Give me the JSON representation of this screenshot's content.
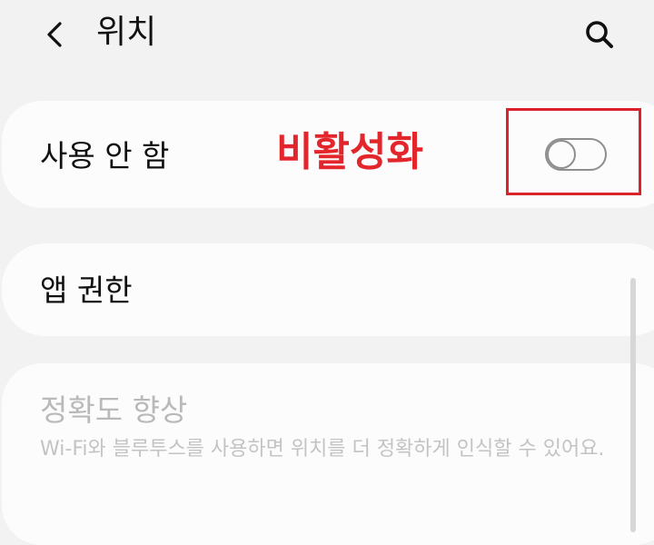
{
  "header": {
    "back_icon": "chevron-left-icon",
    "title": "위치",
    "search_icon": "search-icon"
  },
  "location_toggle": {
    "label": "사용 안 함",
    "state": "off",
    "annotation": "비활성화",
    "annotation_color": "#e3262b",
    "highlight_color": "#d9232a"
  },
  "app_permissions": {
    "label": "앱 권한"
  },
  "improve_accuracy": {
    "title": "정확도 향상",
    "description": "Wi-Fi와 블루투스를 사용하면 위치를 더 정확하게 인식할 수 있어요.",
    "enabled": false
  }
}
